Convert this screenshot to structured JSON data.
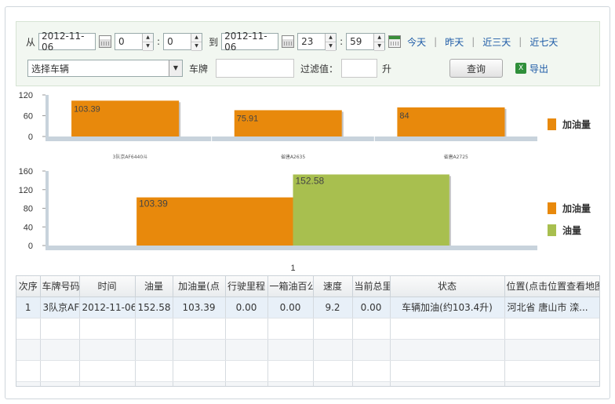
{
  "filter": {
    "from_label": "从",
    "start_date": "2012-11-06",
    "start_hour": "0",
    "start_min": "0",
    "colon": ":",
    "to_label": "到",
    "end_date": "2012-11-06",
    "end_hour": "23",
    "end_min": "59",
    "quick_links": [
      "今天",
      "昨天",
      "近三天",
      "近七天"
    ],
    "vehicle_select": "选择车辆",
    "plate_label": "车牌",
    "plate_value": "",
    "filter_label": "过滤值：",
    "filter_value": "",
    "unit": "升",
    "query_button": "查询",
    "export_label": "导出"
  },
  "chart_data": [
    {
      "type": "bar",
      "categories": [
        "3队京AF6440斗",
        "省唐A2635",
        "省唐A2725"
      ],
      "series": [
        {
          "name": "加油量",
          "values": [
            103.39,
            75.91,
            84
          ],
          "color": "#e8890c"
        }
      ],
      "data_labels": [
        "103.39",
        "75.91",
        "84"
      ],
      "ylim": [
        0,
        120
      ],
      "yticks": [
        "120",
        "60",
        "0"
      ],
      "grid": false,
      "legend": "right"
    },
    {
      "type": "bar",
      "categories": [
        "1"
      ],
      "series": [
        {
          "name": "加油量",
          "values": [
            103.39
          ],
          "color": "#e8890c"
        },
        {
          "name": "油量",
          "values": [
            152.58
          ],
          "color": "#a8bf4f"
        }
      ],
      "data_labels": [
        "103.39",
        "152.58"
      ],
      "ylim": [
        0,
        160
      ],
      "yticks": [
        "160",
        "120",
        "80",
        "40",
        "0"
      ],
      "grid": false,
      "legend": "right"
    }
  ],
  "table": {
    "columns": [
      "次序",
      "车牌号码",
      "时间",
      "油量",
      "加油量(点",
      "行驶里程",
      "一箱油百公",
      "速度",
      "当前总里",
      "状态",
      "位置(点击位置查看地图)"
    ],
    "column_widths": [],
    "rows": [
      [
        "1",
        "3队京AF",
        "2012-11-06",
        "152.58",
        "103.39",
        "0.00",
        "0.00",
        "9.2",
        "0.00",
        "车辆加油(约103.4升)",
        "河北省 唐山市 滦..."
      ]
    ]
  }
}
